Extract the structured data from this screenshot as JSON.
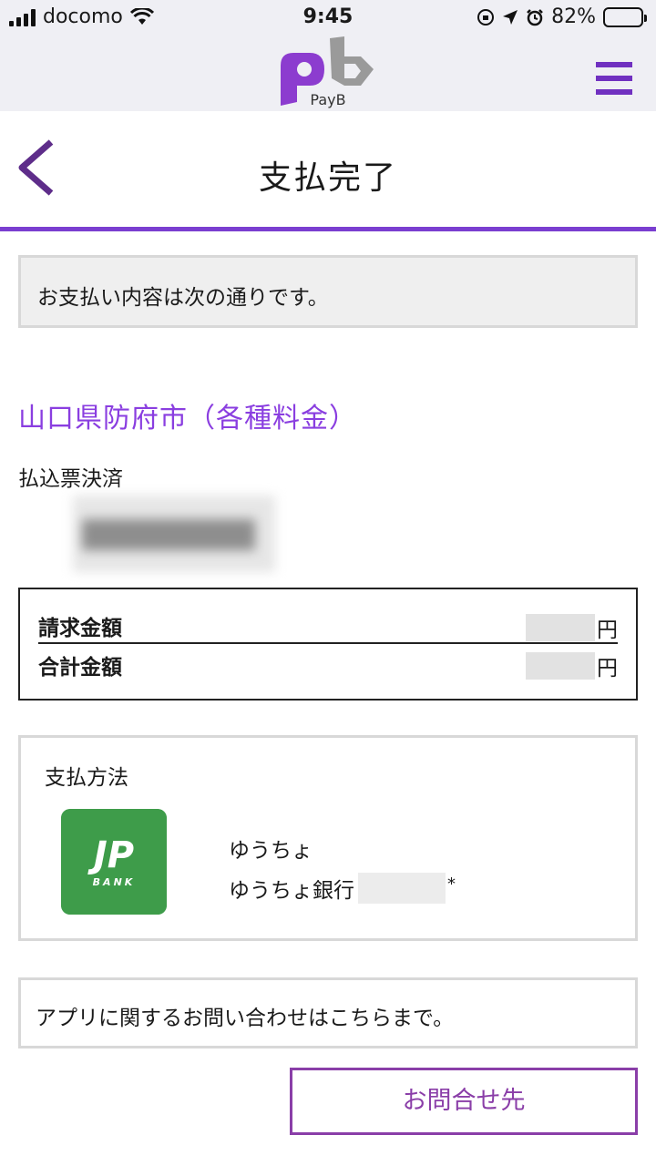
{
  "status_bar": {
    "carrier": "docomo",
    "time": "9:45",
    "battery": "82%",
    "battery_level": 0.82
  },
  "header": {
    "logo_text": "PayB"
  },
  "title_bar": {
    "title": "支払完了"
  },
  "notice": {
    "text": "お支払い内容は次の通りです。"
  },
  "payment": {
    "merchant": "山口県防府市（各種料金）",
    "type": "払込票決済"
  },
  "amounts": {
    "rows": [
      {
        "label": "請求金額",
        "unit": "円"
      },
      {
        "label": "合計金額",
        "unit": "円"
      }
    ]
  },
  "method": {
    "title": "支払方法",
    "icon_text": "JP",
    "icon_sub": "BANK",
    "bank_name": "ゆうちょ",
    "bank_account_label": "ゆうちょ銀行",
    "asterisk": "*"
  },
  "contact": {
    "note": "アプリに関するお問い合わせはこちらまで。",
    "button": "お問合せ先"
  },
  "colors": {
    "accent": "#7a3ed0",
    "merchant": "#8a3ee0",
    "button": "#8a3ea8",
    "jp_bank_green": "#3e9c4a"
  }
}
